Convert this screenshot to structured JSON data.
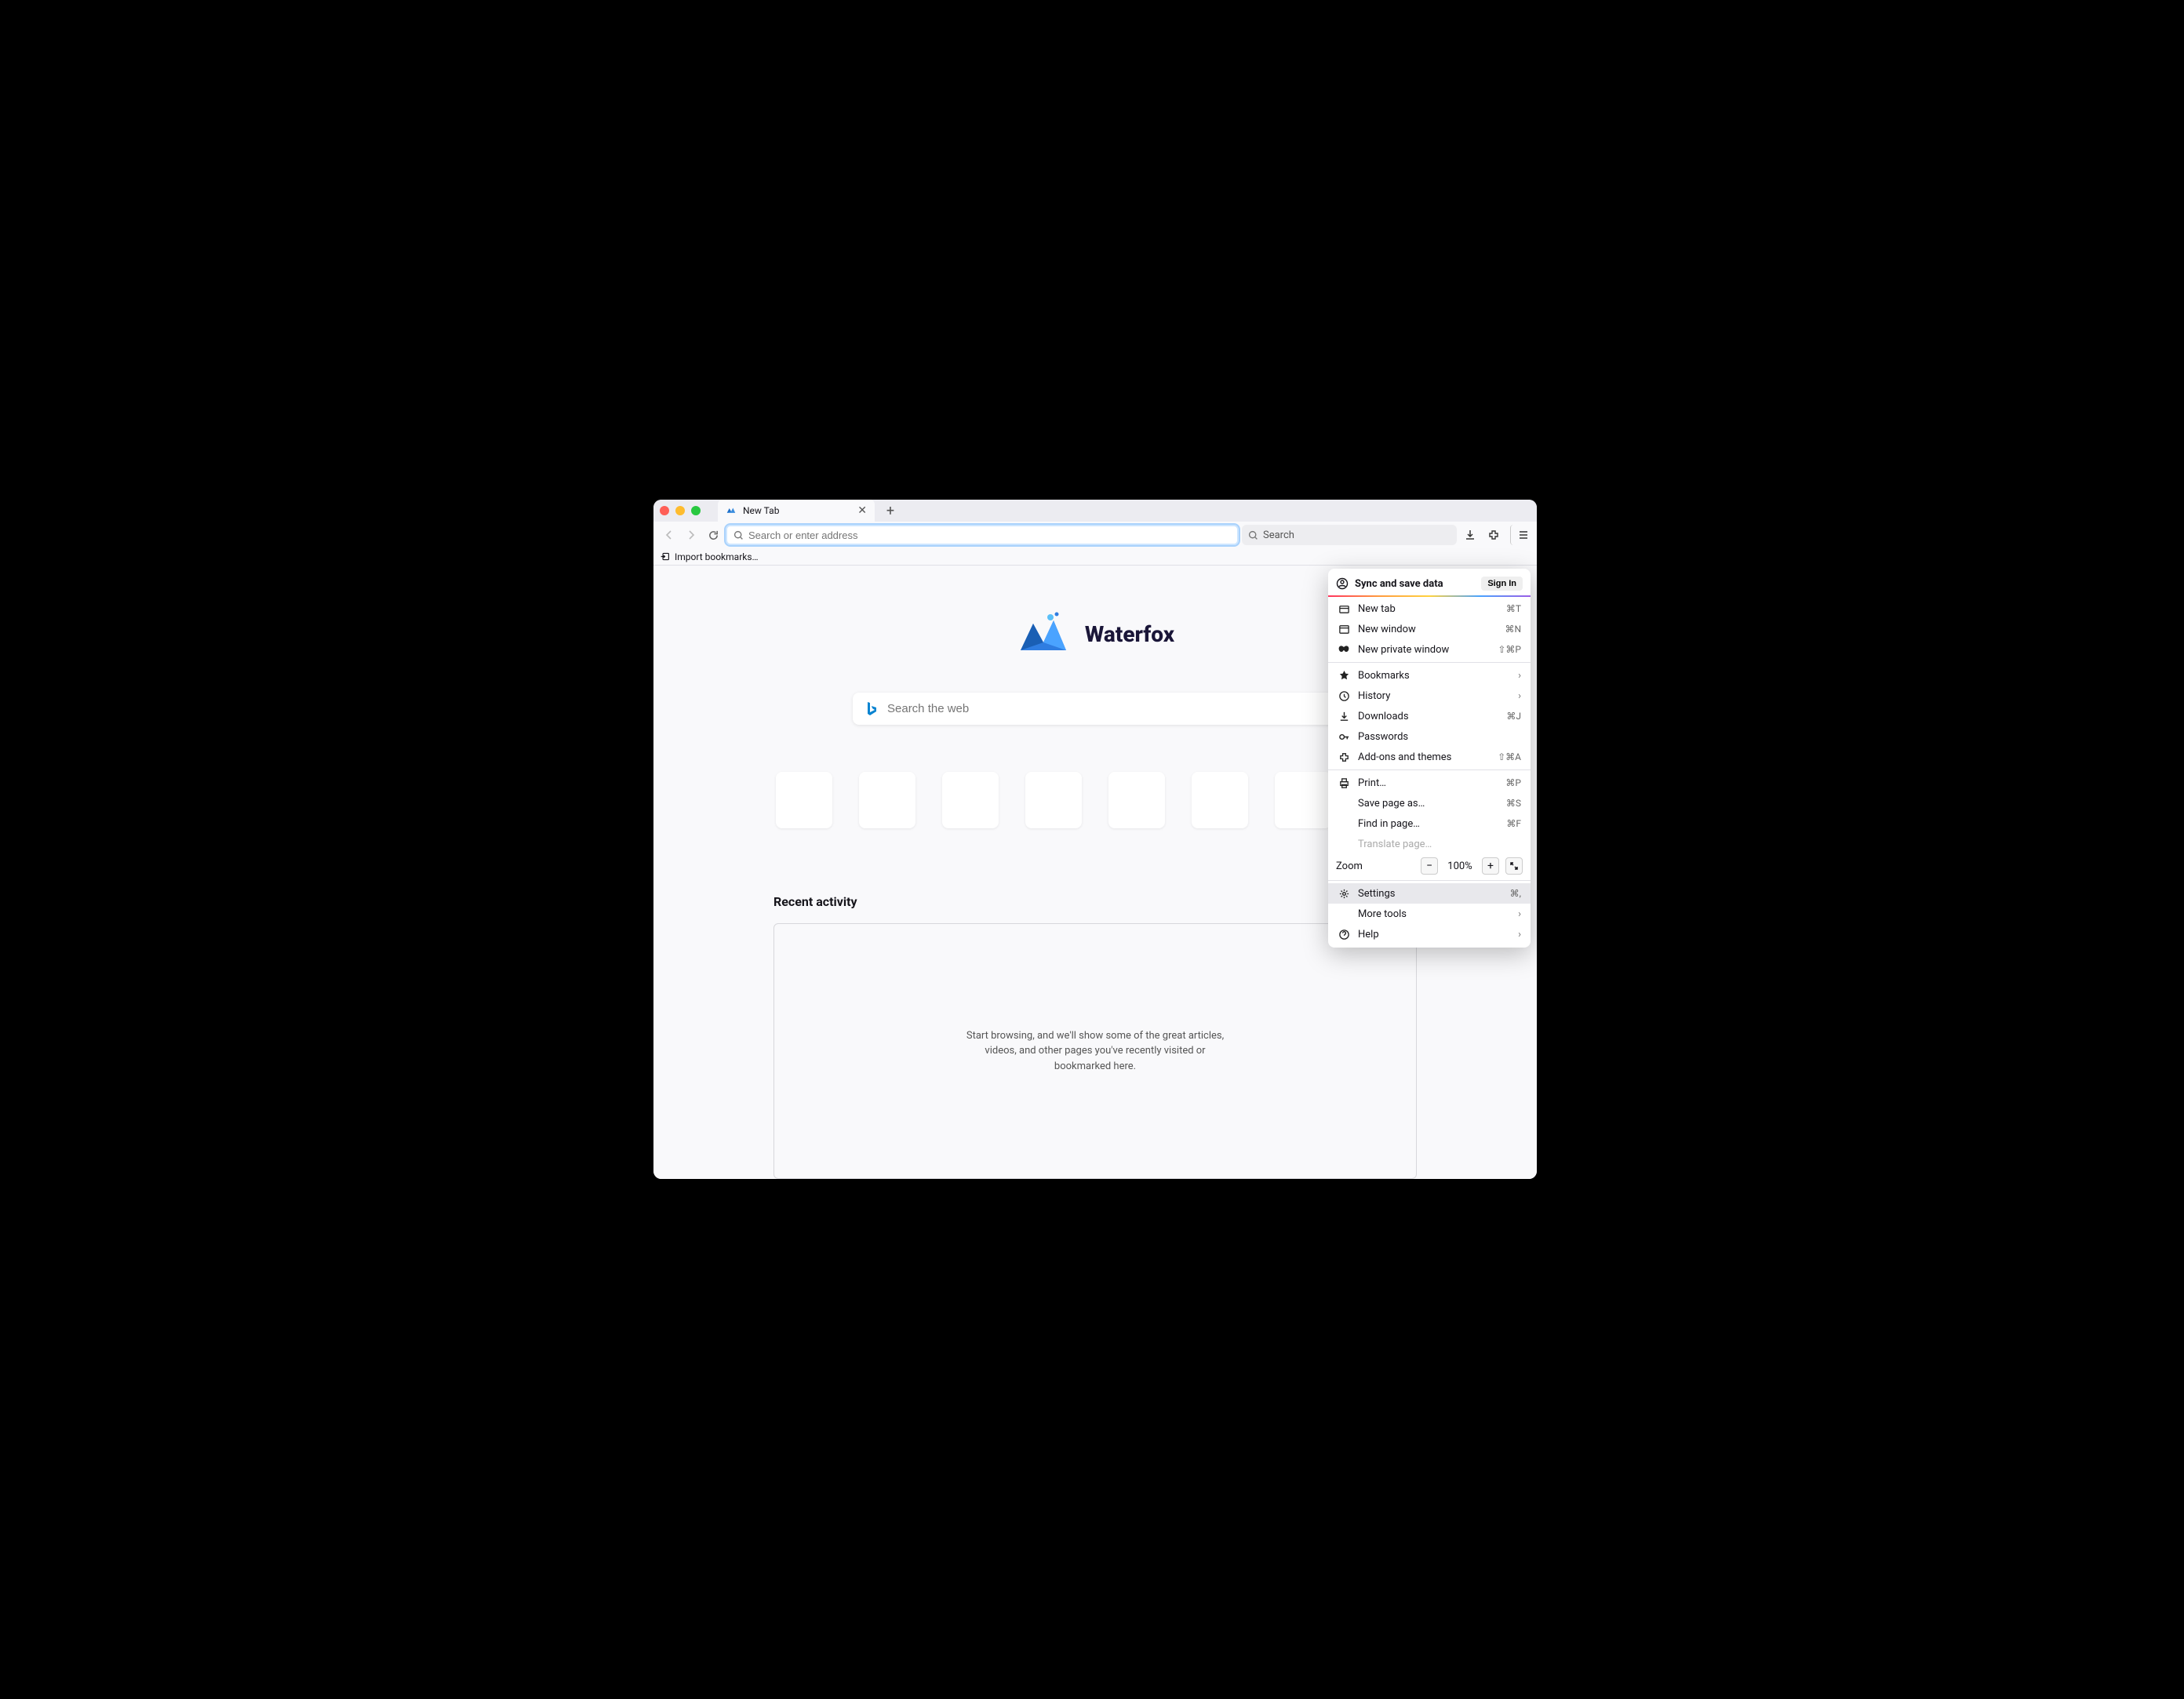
{
  "tab": {
    "title": "New Tab"
  },
  "urlbar": {
    "placeholder": "Search or enter address"
  },
  "searchbox": {
    "placeholder": "Search"
  },
  "bookmark_import": "Import bookmarks…",
  "brand": "Waterfox",
  "websearch": {
    "placeholder": "Search the web"
  },
  "recent": {
    "heading": "Recent activity",
    "empty": "Start browsing, and we'll show some of the great articles, videos, and other pages you've recently visited or bookmarked here."
  },
  "menu": {
    "sync_title": "Sync and save data",
    "signin": "Sign In",
    "items": {
      "new_tab": {
        "label": "New tab",
        "shortcut": "⌘T"
      },
      "new_window": {
        "label": "New window",
        "shortcut": "⌘N"
      },
      "new_private": {
        "label": "New private window",
        "shortcut": "⇧⌘P"
      },
      "bookmarks": {
        "label": "Bookmarks"
      },
      "history": {
        "label": "History"
      },
      "downloads": {
        "label": "Downloads",
        "shortcut": "⌘J"
      },
      "passwords": {
        "label": "Passwords"
      },
      "addons": {
        "label": "Add-ons and themes",
        "shortcut": "⇧⌘A"
      },
      "print": {
        "label": "Print…",
        "shortcut": "⌘P"
      },
      "save_as": {
        "label": "Save page as…",
        "shortcut": "⌘S"
      },
      "find": {
        "label": "Find in page…",
        "shortcut": "⌘F"
      },
      "translate": {
        "label": "Translate page…"
      },
      "zoom": {
        "label": "Zoom",
        "value": "100%"
      },
      "settings": {
        "label": "Settings",
        "shortcut": "⌘,"
      },
      "more_tools": {
        "label": "More tools"
      },
      "help": {
        "label": "Help"
      }
    }
  }
}
